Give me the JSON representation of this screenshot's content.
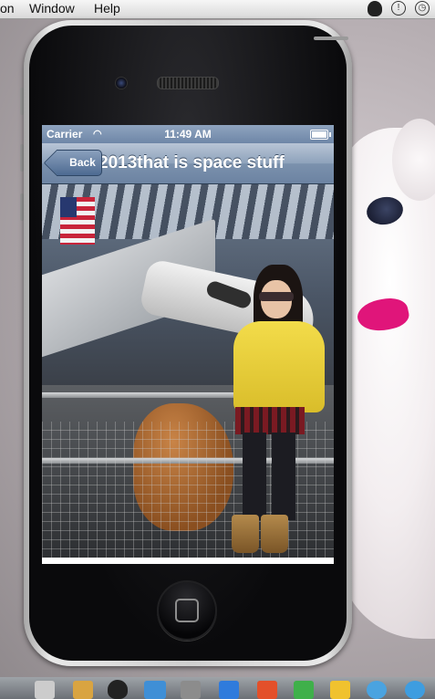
{
  "menubar": {
    "items": [
      "on",
      "Window",
      "Help"
    ],
    "status_icons": [
      "qq-penguin-icon",
      "alert-icon",
      "time-machine-icon"
    ]
  },
  "simulator": {
    "device": "iPhone",
    "status_bar": {
      "carrier": "Carrier",
      "wifi_icon": "wifi-icon",
      "time": "11:49 AM",
      "battery_level": 1.0
    },
    "nav_bar": {
      "back_label": "Back",
      "title": "2013that is space stuff"
    },
    "content": {
      "photo_icon": "photo-image"
    }
  },
  "colors": {
    "nav_bar": "#7b91ad",
    "status_bar": "#6e86a7",
    "back_button": "#4d6a91",
    "plush_accent": "#e0157a"
  },
  "dock": {
    "icons": [
      "dock-app-icon"
    ]
  }
}
